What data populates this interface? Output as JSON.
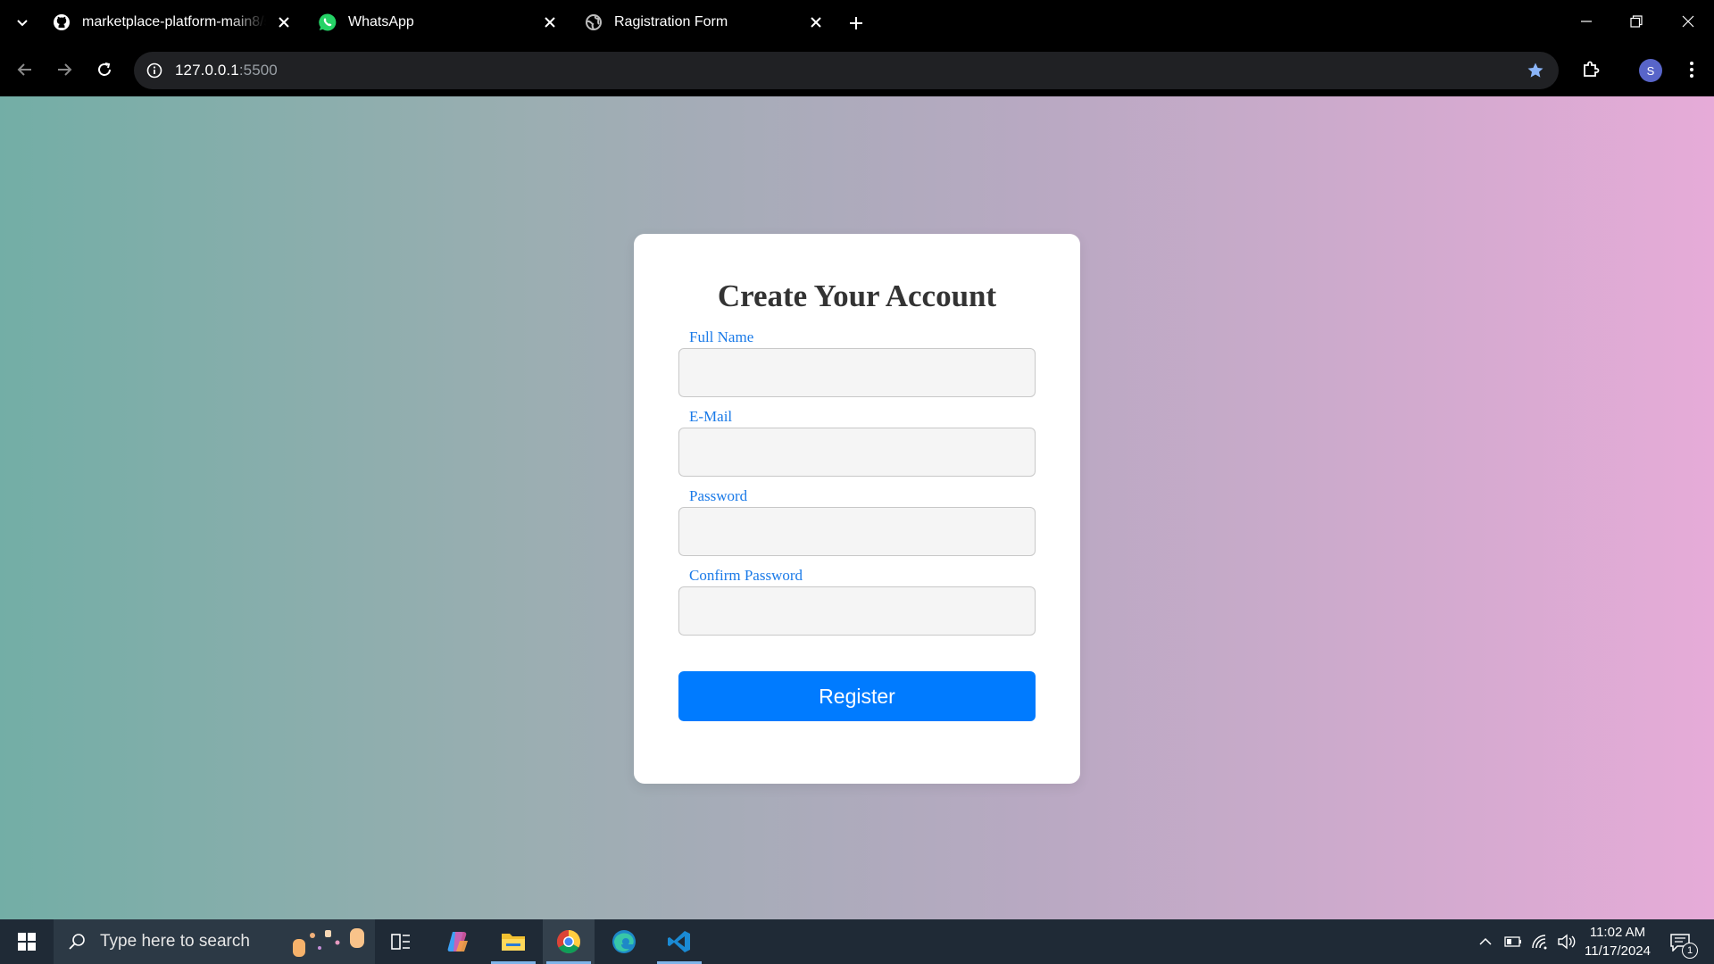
{
  "browser": {
    "tabs": [
      {
        "title": "marketplace-platform-main8/st",
        "icon": "github-icon"
      },
      {
        "title": "WhatsApp",
        "icon": "whatsapp-icon"
      },
      {
        "title": "Ragistration Form",
        "icon": "globe-icon"
      }
    ],
    "address_bar": {
      "host": "127.0.0.1",
      "port": ":5500"
    },
    "profile_initial": "S"
  },
  "page": {
    "title": "Create Your Account",
    "fields": [
      {
        "label": "Full Name",
        "value": ""
      },
      {
        "label": "E-Mail",
        "value": ""
      },
      {
        "label": "Password",
        "value": ""
      },
      {
        "label": "Confirm Password",
        "value": ""
      }
    ],
    "submit_label": "Register",
    "colors": {
      "accent": "#007bff",
      "label": "#1a7ae8",
      "heading": "#333333"
    }
  },
  "taskbar": {
    "search_placeholder": "Type here to search",
    "apps": [
      "task-view",
      "copilot",
      "file-explorer",
      "chrome",
      "edge",
      "vscode"
    ],
    "time": "11:02 AM",
    "date": "11/17/2024",
    "notification_count": "1"
  }
}
